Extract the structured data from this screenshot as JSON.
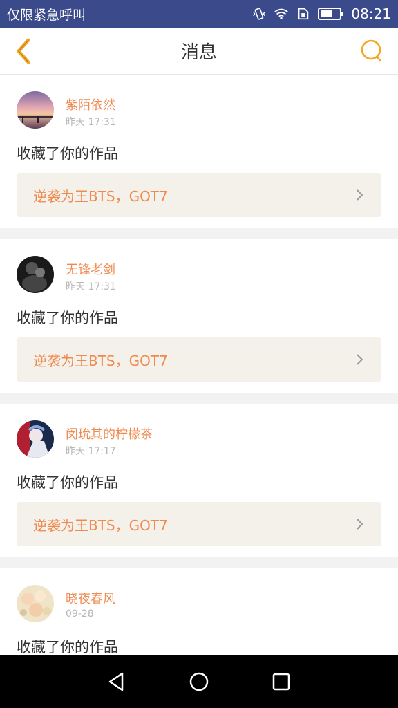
{
  "status_bar": {
    "carrier_text": "仅限紧急呼叫",
    "time": "08:21",
    "icons": [
      "vibrate-icon",
      "wifi-icon",
      "sim-icon",
      "battery-icon"
    ]
  },
  "header": {
    "title": "消息",
    "back_icon": "chevron-left-icon",
    "search_icon": "search-icon",
    "accent_color": "#f5a623"
  },
  "messages": [
    {
      "user": "紫陌依然",
      "time": "昨天 17:31",
      "action": "收藏了你的作品",
      "work_title": "逆袭为王BTS，GOT7"
    },
    {
      "user": "无锋老剑",
      "time": "昨天 17:31",
      "action": "收藏了你的作品",
      "work_title": "逆袭为王BTS，GOT7"
    },
    {
      "user": "闵玧其的柠檬茶",
      "time": "昨天 17:17",
      "action": "收藏了你的作品",
      "work_title": "逆袭为王BTS，GOT7"
    },
    {
      "user": "晓夜春风",
      "time": "09-28",
      "action": "收藏了你的作品",
      "work_title": ""
    }
  ],
  "nav_bar": {
    "icons": [
      "back-triangle-icon",
      "home-circle-icon",
      "recents-square-icon"
    ]
  },
  "colors": {
    "status_bar_bg": "#3a4a8a",
    "name_color": "#f08a50",
    "work_bg": "#f4f1ea"
  }
}
